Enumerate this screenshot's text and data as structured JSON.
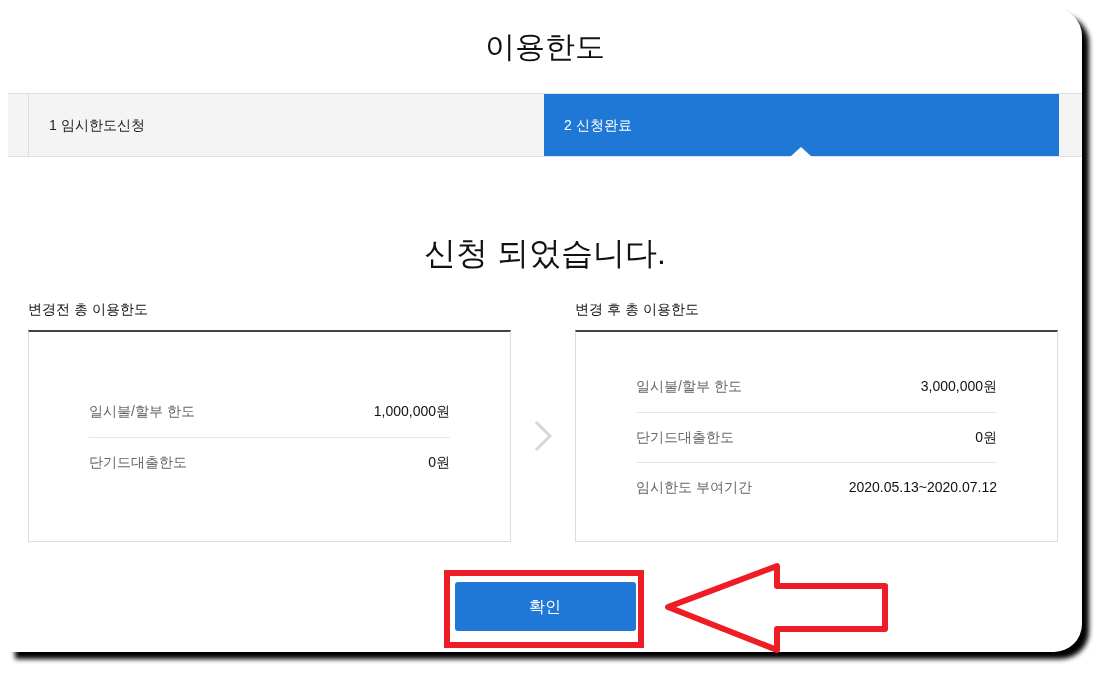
{
  "window": {
    "title": "이용한도"
  },
  "steps": [
    {
      "number": "1",
      "label": "임시한도신청",
      "selected": false
    },
    {
      "number": "2",
      "label": "신청완료",
      "selected": true
    }
  ],
  "message": "신청 되었습니다.",
  "panels": [
    {
      "title": "변경전 총 이용한도",
      "rows": [
        {
          "label": "일시불/할부 한도",
          "value": "1,000,000원"
        },
        {
          "label": "단기드대출한도",
          "value": "0원"
        }
      ]
    },
    {
      "title": "변경 후 총 이용한도",
      "rows": [
        {
          "label": "일시불/할부 한도",
          "value": "3,000,000원"
        },
        {
          "label": "단기드대출한도",
          "value": "0원"
        },
        {
          "label": "임시한도 부여기간",
          "value": "2020.05.13~2020.07.12"
        }
      ]
    }
  ],
  "confirm_button": "확인"
}
